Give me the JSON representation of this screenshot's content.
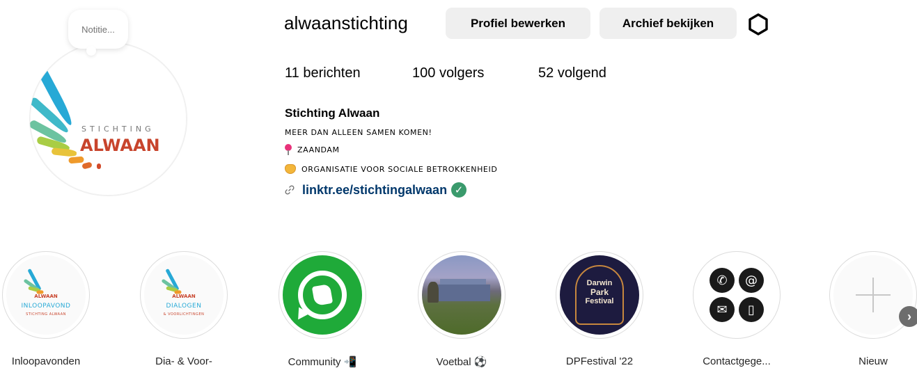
{
  "profile": {
    "username": "alwaanstichting",
    "note": "Notitie...",
    "avatar_logo": {
      "top_text": "STICHTING",
      "main_text": "ALWAAN"
    },
    "edit_button": "Profiel bewerken",
    "archive_button": "Archief bekijken",
    "settings_icon": "gear-icon"
  },
  "stats": {
    "posts_count": "11",
    "posts_label": "berichten",
    "followers_count": "100",
    "followers_label": "volgers",
    "following_count": "52",
    "following_label": "volgend"
  },
  "bio": {
    "name": "Stichting Alwaan",
    "line1": "MEER DAN ALLEEN SAMEN KOMEN!",
    "line2": "ZAANDAM",
    "line2_icon": "pin-icon",
    "line3": "ORGANISATIE VOOR SOCIALE BETROKKENHEID",
    "line3_icon": "handshake-icon",
    "link": "linktr.ee/stichtingalwaan",
    "link_icon": "link-icon",
    "verified_icon": "check-badge-icon"
  },
  "highlights": [
    {
      "label": "Inloopavonden",
      "logo": {
        "line1": "ALWAAN",
        "line2": "INLOOPAVOND",
        "line3": "STICHTING ALWAAN"
      }
    },
    {
      "label": "Dia- & Voor-",
      "logo": {
        "line1": "ALWAAN",
        "line2": "DIALOGEN",
        "line3": "& VOORLICHTINGEN"
      }
    },
    {
      "label": "Community 📲",
      "icon": "whatsapp-icon"
    },
    {
      "label": "Voetbal ⚽",
      "icon": "photo-field"
    },
    {
      "label": "DPFestival '22",
      "logo": {
        "line1": "Darwin",
        "line2": "Park",
        "line3": "Festival"
      }
    },
    {
      "label": "Contactgege...",
      "icons": [
        "phone-icon",
        "at-icon",
        "mail-icon",
        "mobile-icon"
      ]
    },
    {
      "label": "Nieuw",
      "icon": "plus-icon"
    }
  ],
  "colors": {
    "button_bg": "#efefef",
    "link": "#00376b",
    "verified": "#3a9a6c",
    "whatsapp": "#1faa39",
    "brand_red": "#c8442c",
    "brand_blue": "#27a9d6"
  }
}
